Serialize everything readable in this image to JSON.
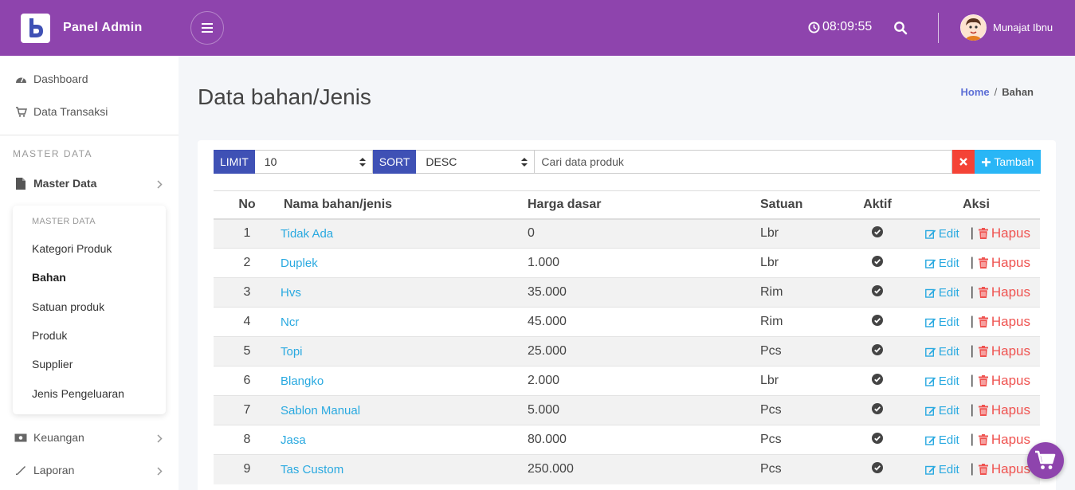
{
  "app": {
    "brand": "Panel Admin",
    "clock": "08:09:55",
    "user": "Munajat Ibnu",
    "accent": "#8e44ad"
  },
  "sidebar": {
    "items": [
      {
        "label": "Dashboard",
        "icon": "dashboard-icon"
      },
      {
        "label": "Data Transaksi",
        "icon": "cart-icon"
      }
    ],
    "section_header": "MASTER DATA",
    "master": {
      "label": "Master Data",
      "icon": "file-icon"
    },
    "submenu_title": "MASTER DATA",
    "submenu": [
      "Kategori Produk",
      "Bahan",
      "Satuan produk",
      "Produk",
      "Supplier",
      "Jenis Pengeluaran"
    ],
    "submenu_active": "Bahan",
    "bottom": [
      {
        "label": "Keuangan",
        "icon": "money-icon"
      },
      {
        "label": "Laporan",
        "icon": "report-icon"
      }
    ]
  },
  "page": {
    "title": "Data bahan/Jenis",
    "breadcrumb": {
      "home": "Home",
      "sep": "/",
      "current": "Bahan"
    }
  },
  "toolbar": {
    "limit_label": "LIMIT",
    "limit_value": "10",
    "sort_label": "SORT",
    "sort_value": "DESC",
    "search_placeholder": "Cari data produk",
    "add_label": "Tambah"
  },
  "table": {
    "headers": [
      "No",
      "Nama bahan/jenis",
      "Harga dasar",
      "Satuan",
      "Aktif",
      "Aksi"
    ],
    "edit_label": "Edit",
    "delete_label": "Hapus",
    "rows": [
      {
        "no": "1",
        "name": "Tidak Ada",
        "harga": "0",
        "satuan": "Lbr"
      },
      {
        "no": "2",
        "name": "Duplek",
        "harga": "1.000",
        "satuan": "Lbr"
      },
      {
        "no": "3",
        "name": "Hvs",
        "harga": "35.000",
        "satuan": "Rim"
      },
      {
        "no": "4",
        "name": "Ncr",
        "harga": "45.000",
        "satuan": "Rim"
      },
      {
        "no": "5",
        "name": "Topi",
        "harga": "25.000",
        "satuan": "Pcs"
      },
      {
        "no": "6",
        "name": "Blangko",
        "harga": "2.000",
        "satuan": "Lbr"
      },
      {
        "no": "7",
        "name": "Sablon Manual",
        "harga": "5.000",
        "satuan": "Pcs"
      },
      {
        "no": "8",
        "name": "Jasa",
        "harga": "80.000",
        "satuan": "Pcs"
      },
      {
        "no": "9",
        "name": "Tas Custom",
        "harga": "250.000",
        "satuan": "Pcs"
      }
    ]
  }
}
